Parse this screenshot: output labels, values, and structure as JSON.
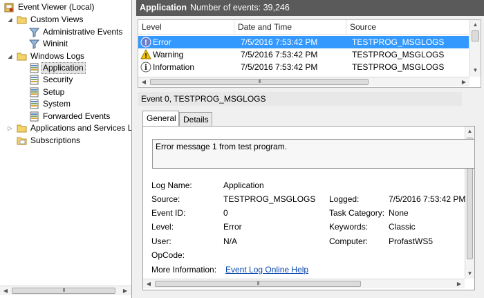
{
  "tree": {
    "items": [
      {
        "label": "Event Viewer (Local)",
        "icon": "event-viewer-icon"
      },
      {
        "label": "Custom Views",
        "icon": "folder-icon"
      },
      {
        "label": "Administrative Events",
        "icon": "filter-icon"
      },
      {
        "label": "Wininit",
        "icon": "filter-icon"
      },
      {
        "label": "Windows Logs",
        "icon": "folder-icon"
      },
      {
        "label": "Application",
        "icon": "log-icon"
      },
      {
        "label": "Security",
        "icon": "log-icon"
      },
      {
        "label": "Setup",
        "icon": "log-icon"
      },
      {
        "label": "System",
        "icon": "log-icon"
      },
      {
        "label": "Forwarded Events",
        "icon": "log-icon"
      },
      {
        "label": "Applications and Services Lo",
        "icon": "folder-icon"
      },
      {
        "label": "Subscriptions",
        "icon": "subscriptions-icon"
      }
    ]
  },
  "header": {
    "log_name": "Application",
    "count_text": "Number of events: 39,246"
  },
  "list": {
    "columns": [
      "Level",
      "Date and Time",
      "Source"
    ],
    "rows": [
      {
        "level": "Error",
        "date": "7/5/2016 7:53:42 PM",
        "source": "TESTPROG_MSGLOGS",
        "icon": "error-icon"
      },
      {
        "level": "Warning",
        "date": "7/5/2016 7:53:42 PM",
        "source": "TESTPROG_MSGLOGS",
        "icon": "warning-icon"
      },
      {
        "level": "Information",
        "date": "7/5/2016 7:53:42 PM",
        "source": "TESTPROG_MSGLOGS",
        "icon": "information-icon"
      }
    ]
  },
  "details": {
    "event_title": "Event 0, TESTPROG_MSGLOGS",
    "tabs": [
      "General",
      "Details"
    ],
    "message": "Error message 1 from test program.",
    "labels": {
      "log_name": "Log Name:",
      "source": "Source:",
      "event_id": "Event ID:",
      "level": "Level:",
      "user": "User:",
      "opcode": "OpCode:",
      "more_info": "More Information:",
      "logged": "Logged:",
      "task_category": "Task Category:",
      "keywords": "Keywords:",
      "computer": "Computer:"
    },
    "values": {
      "log_name": "Application",
      "source": "TESTPROG_MSGLOGS",
      "event_id": "0",
      "level": "Error",
      "user": "N/A",
      "opcode": "",
      "more_info_link": "Event Log Online Help",
      "logged": "7/5/2016 7:53:42 PM",
      "task_category": "None",
      "keywords": "Classic",
      "computer": "ProfastWS5"
    }
  },
  "colors": {
    "selection": "#3399ff",
    "header_bg": "#5a5a5a",
    "link": "#0645ad"
  }
}
